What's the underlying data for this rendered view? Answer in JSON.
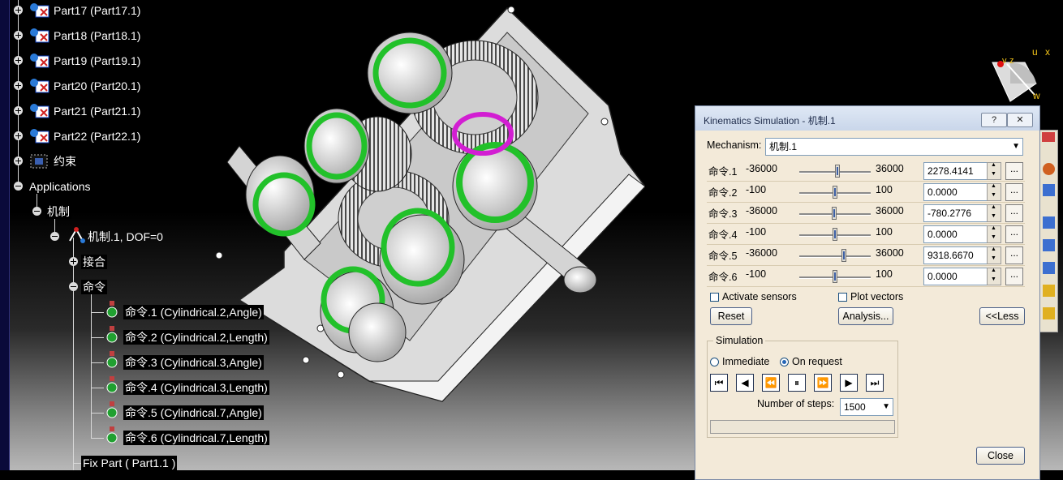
{
  "tree": {
    "parts": [
      {
        "label": "Part17 (Part17.1)"
      },
      {
        "label": "Part18 (Part18.1)"
      },
      {
        "label": "Part19 (Part19.1)"
      },
      {
        "label": "Part20 (Part20.1)"
      },
      {
        "label": "Part21 (Part21.1)"
      },
      {
        "label": "Part22 (Part22.1)"
      }
    ],
    "constraints_label": "约束",
    "applications_label": "Applications",
    "mechanisms_label": "机制",
    "mechanism_label": "机制.1, DOF=0",
    "joints_label": "接合",
    "commands_label": "命令",
    "commands": [
      {
        "label": "命令.1 (Cylindrical.2,Angle)"
      },
      {
        "label": "命令.2 (Cylindrical.2,Length)"
      },
      {
        "label": "命令.3 (Cylindrical.3,Angle)"
      },
      {
        "label": "命令.4 (Cylindrical.3,Length)"
      },
      {
        "label": "命令.5 (Cylindrical.7,Angle)"
      },
      {
        "label": "命令.6 (Cylindrical.7,Length)"
      }
    ],
    "fix_part_label": "Fix Part ( Part1.1 )"
  },
  "compass": {
    "u_label": "u",
    "x_label": "x",
    "v_label": "v",
    "z_label": "z",
    "w_label": "w"
  },
  "dialog": {
    "title": "Kinematics Simulation - 机制.1",
    "help_label": "?",
    "close_x_label": "✕",
    "mechanism_label": "Mechanism:",
    "mechanism_value": "机制.1",
    "commands": [
      {
        "name": "命令.1",
        "min": "-36000",
        "max": "36000",
        "value": "2278.4141",
        "fraction": 0.5316
      },
      {
        "name": "命令.2",
        "min": "-100",
        "max": "100",
        "value": "0.0000",
        "fraction": 0.5
      },
      {
        "name": "命令.3",
        "min": "-36000",
        "max": "36000",
        "value": "-780.2776",
        "fraction": 0.4892
      },
      {
        "name": "命令.4",
        "min": "-100",
        "max": "100",
        "value": "0.0000",
        "fraction": 0.5
      },
      {
        "name": "命令.5",
        "min": "-36000",
        "max": "36000",
        "value": "9318.6670",
        "fraction": 0.6294
      },
      {
        "name": "命令.6",
        "min": "-100",
        "max": "100",
        "value": "0.0000",
        "fraction": 0.5
      }
    ],
    "more_button_label": "...",
    "activate_sensors_label": "Activate sensors",
    "plot_vectors_label": "Plot vectors",
    "reset_label": "Reset",
    "analysis_label": "Analysis...",
    "less_label": "<<Less",
    "simulation_group_label": "Simulation",
    "immediate_label": "Immediate",
    "on_request_label": "On request",
    "player_buttons": [
      "⏮",
      "◀",
      "⏪",
      "⏸",
      "⏩",
      "▶",
      "⏭"
    ],
    "steps_label": "Number of steps:",
    "steps_value": "1500",
    "close_label": "Close"
  }
}
